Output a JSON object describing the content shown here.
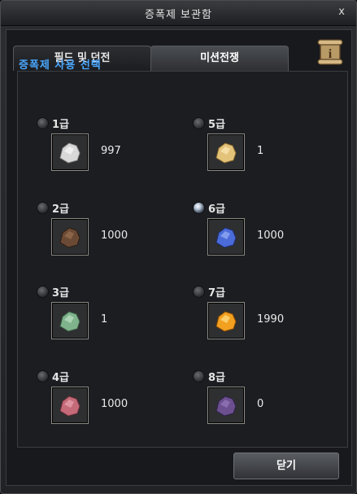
{
  "window": {
    "title": "증폭제 보관함",
    "close_glyph": "x"
  },
  "tabs": [
    {
      "label": "필드 및 던전",
      "active": false
    },
    {
      "label": "미션전쟁",
      "active": true
    }
  ],
  "help_icon": "help-scroll-icon",
  "section_label": "증폭제 사용 선택",
  "grades": [
    {
      "label": "1급",
      "count": "997",
      "selected": false,
      "color": "#d8d8d8"
    },
    {
      "label": "2급",
      "count": "1000",
      "selected": false,
      "color": "#6b4a35"
    },
    {
      "label": "3급",
      "count": "1",
      "selected": false,
      "color": "#7fb38c"
    },
    {
      "label": "4급",
      "count": "1000",
      "selected": false,
      "color": "#c46a78"
    },
    {
      "label": "5급",
      "count": "1",
      "selected": false,
      "color": "#e3c27a"
    },
    {
      "label": "6급",
      "count": "1000",
      "selected": true,
      "color": "#4a6bd8"
    },
    {
      "label": "7급",
      "count": "1990",
      "selected": false,
      "color": "#f2a020"
    },
    {
      "label": "8급",
      "count": "0",
      "selected": false,
      "color": "#6b4f8f"
    }
  ],
  "footer": {
    "close_label": "닫기"
  }
}
